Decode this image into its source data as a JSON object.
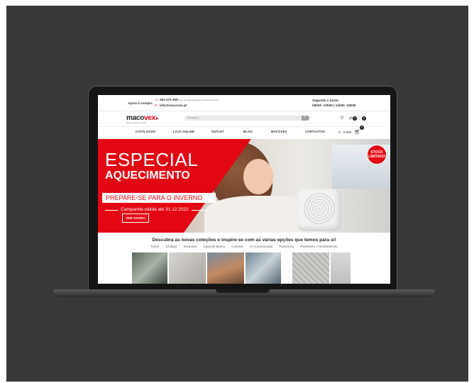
{
  "topbar": {
    "support_label": "Apoio à compra",
    "phone": "253 470 250",
    "phone_note": "(custo de chamada para rede fixa nacional)",
    "email": "info@macovex.pt",
    "hours_days": "Segunda a Sexta",
    "hours_times": "09h00 -13h00 | 14h00 -18h00"
  },
  "header": {
    "logo_main": "maco",
    "logo_accent": "vex",
    "logo_sub": "para construir melhor",
    "search_placeholder": "Pesquisa...",
    "wishlist_count": "0",
    "compare_count": "0",
    "cart_count": "0",
    "cart_total": "0 - 0,00€"
  },
  "nav": {
    "items": [
      "CATÁLOGOS",
      "LOJA ONLINE",
      "OUTLET",
      "BLOG",
      "MACOVEX",
      "CONTACTOS"
    ]
  },
  "hero": {
    "line1": "ESPECIAL",
    "line2": "AQUECIMENTO",
    "line3": "PREPARE-SE PARA O INVERNO",
    "validity": "Campanha válida até 31.12.2022",
    "cta": "VER AGORA",
    "stock_line1": "STOCK",
    "stock_line2": "LIMITADO"
  },
  "collections": {
    "title": "Descubra as novas coleções e inspire-se com as várias opções que temos para si!",
    "categories": [
      "Todos",
      "Azulejos",
      "Mosaicos",
      "Casa de Banho",
      "Cozinha",
      "Ar Condicionado",
      "Pavimento",
      "Pavimento e Revestimento"
    ]
  },
  "colors": {
    "brand_red": "#e30613",
    "backdrop": "#3a3737"
  }
}
